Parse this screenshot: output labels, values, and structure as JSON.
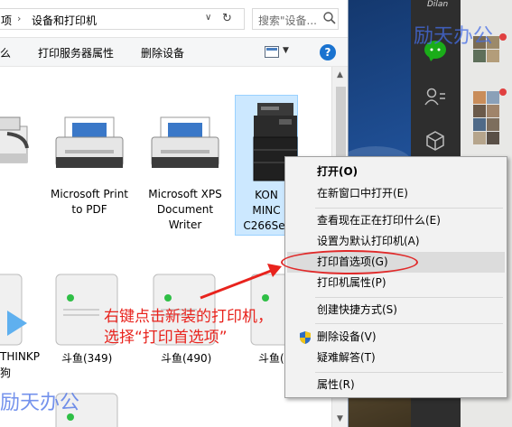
{
  "address": {
    "crumb_partial": "项",
    "crumb_current": "设备和打印机",
    "sep": "›",
    "dropdown": "∨",
    "refresh": "↻"
  },
  "search": {
    "placeholder": "搜索\"设备..."
  },
  "toolbar": {
    "partial_btn": "么",
    "print_server_props": "打印服务器属性",
    "remove_device": "删除设备",
    "view_dropdown": "▼",
    "help": "?"
  },
  "devices": [
    {
      "name_line1": "Microsoft Print",
      "name_line2": "to PDF",
      "name_line3": ""
    },
    {
      "name_line1": "Microsoft XPS",
      "name_line2": "Document",
      "name_line3": "Writer"
    },
    {
      "name_line1": "KON",
      "name_line2": "MINC",
      "name_line3": "C266Ser"
    }
  ],
  "media_devices": [
    {
      "label": "THINKP",
      "label2": "狗"
    },
    {
      "label": "斗鱼(349)"
    },
    {
      "label": "斗鱼(490)"
    },
    {
      "label": "斗鱼("
    }
  ],
  "context_menu": {
    "items": [
      {
        "label": "打开(O)",
        "bold": true
      },
      {
        "label": "在新窗口中打开(E)"
      },
      {
        "label": "查看现在正在打印什么(E)"
      },
      {
        "label": "设置为默认打印机(A)"
      },
      {
        "label": "打印首选项(G)",
        "highlighted": true
      },
      {
        "label": "打印机属性(P)"
      },
      {
        "label": "创建快捷方式(S)"
      },
      {
        "label": "删除设备(V)"
      },
      {
        "label": "疑难解答(T)"
      },
      {
        "label": "属性(R)"
      }
    ]
  },
  "annotation": {
    "line1": "右键点击新装的打印机，",
    "line2": "选择“打印首选项”"
  },
  "watermarks": {
    "top": "励天办公",
    "bottom": "励天办公"
  },
  "right_app": {
    "label": "Dilan"
  },
  "colors": {
    "annotation_red": "#e8231d",
    "menu_bg": "#f2f2f2",
    "selection_blue": "#cce8ff",
    "wechat_green": "#1aad19"
  }
}
